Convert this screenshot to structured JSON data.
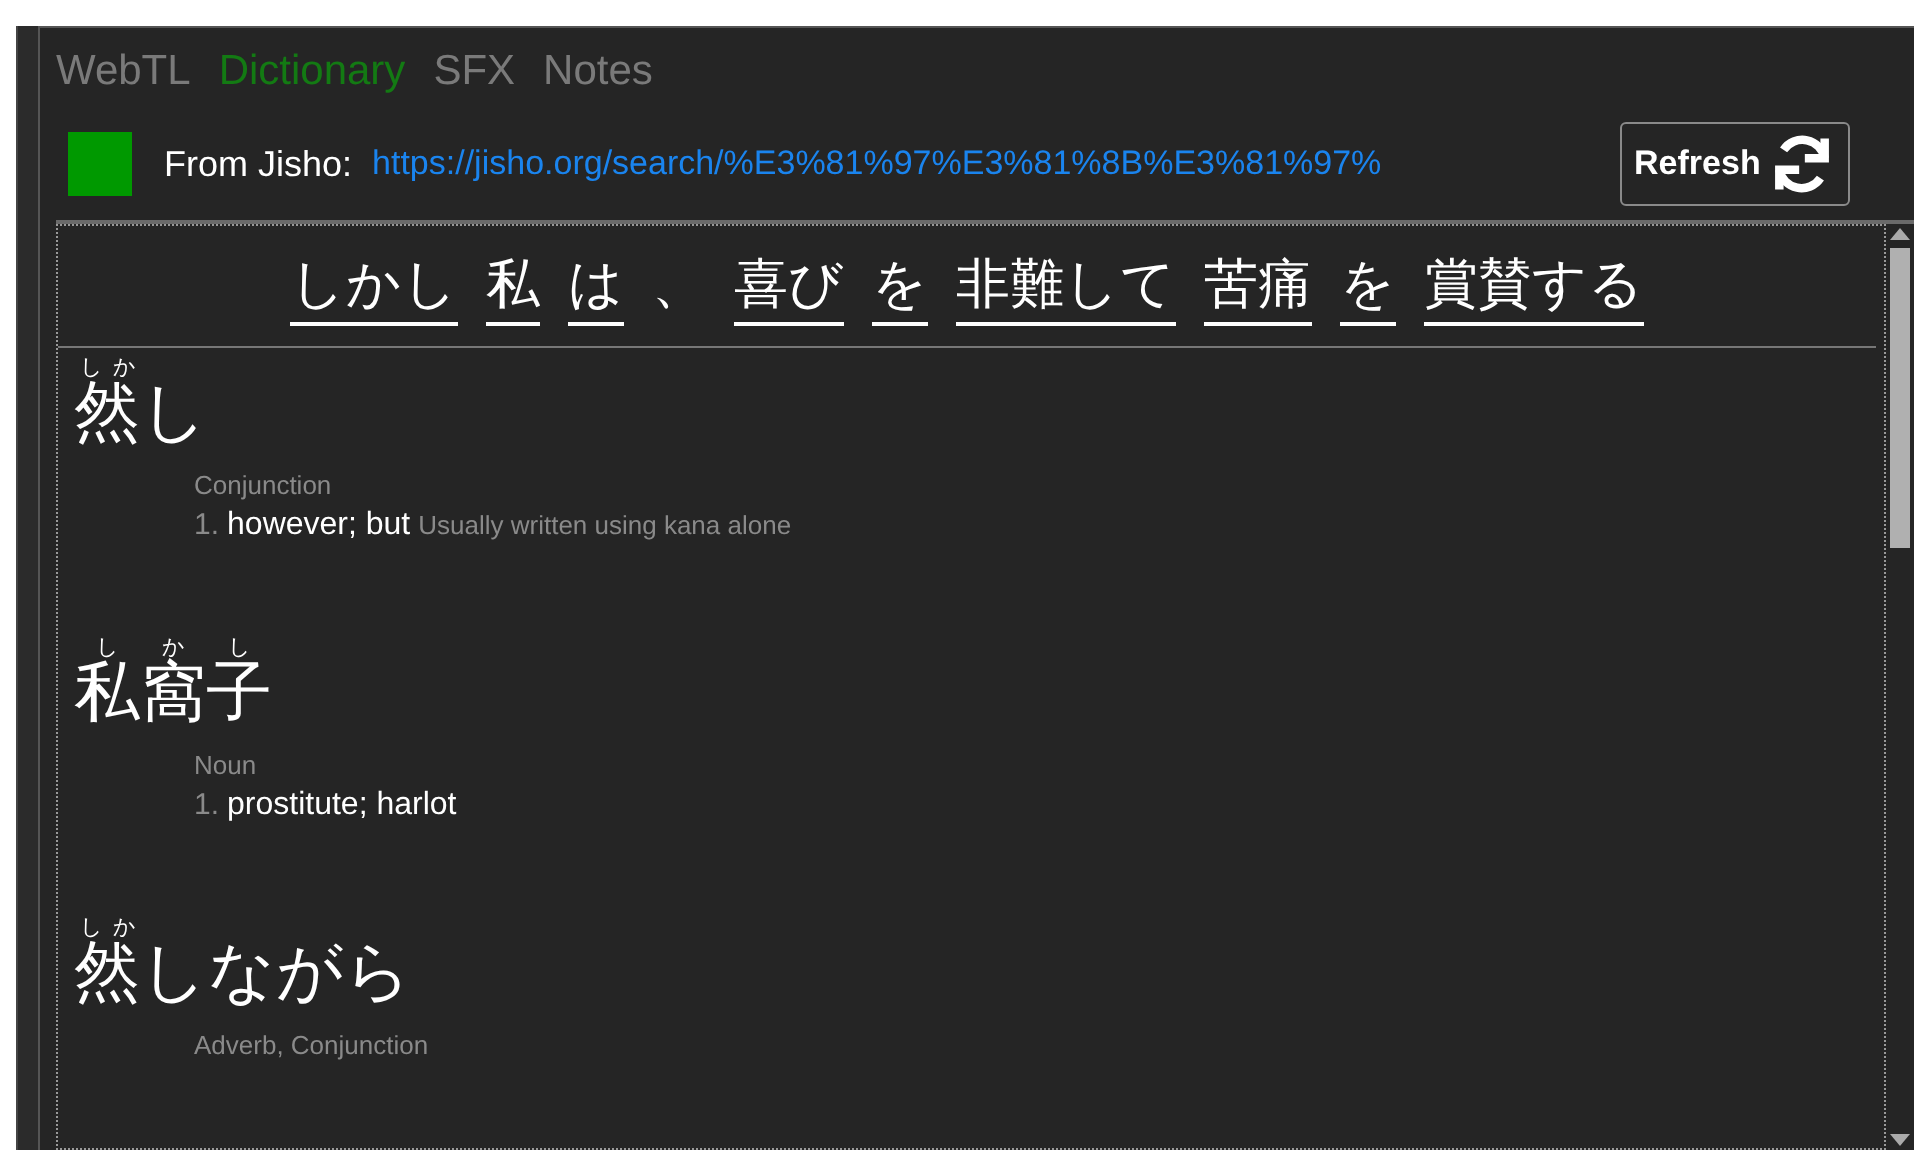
{
  "tabs": [
    {
      "label": "WebTL",
      "selected": false
    },
    {
      "label": "Dictionary",
      "selected": true
    },
    {
      "label": "SFX",
      "selected": false
    },
    {
      "label": "Notes",
      "selected": false
    }
  ],
  "source": {
    "connected": true,
    "label": "From Jisho:",
    "url": "https://jisho.org/search/%E3%81%97%E3%81%8B%E3%81%97%",
    "refresh_label": "Refresh"
  },
  "sentence": [
    {
      "text": "しかし",
      "underlined": true
    },
    {
      "text": "私",
      "underlined": true
    },
    {
      "text": "は",
      "underlined": true
    },
    {
      "text": "、",
      "underlined": false
    },
    {
      "text": "喜び",
      "underlined": true
    },
    {
      "text": "を",
      "underlined": true
    },
    {
      "text": "非難して",
      "underlined": true
    },
    {
      "text": "苦痛",
      "underlined": true
    },
    {
      "text": "を",
      "underlined": true
    },
    {
      "text": "賞賛する",
      "underlined": true
    }
  ],
  "entries": [
    {
      "word": [
        {
          "text": "然",
          "ruby": "しか"
        },
        {
          "text": "し"
        }
      ],
      "pos": "Conjunction",
      "senses": [
        {
          "number": "1.",
          "gloss": "however; but",
          "note": "Usually written using kana alone"
        }
      ]
    },
    {
      "word": [
        {
          "text": "私",
          "ruby": "し"
        },
        {
          "text": "窩",
          "ruby": "か"
        },
        {
          "text": "子",
          "ruby": "し"
        }
      ],
      "pos": "Noun",
      "senses": [
        {
          "number": "1.",
          "gloss": "prostitute; harlot"
        }
      ]
    },
    {
      "word": [
        {
          "text": "然",
          "ruby": "しか"
        },
        {
          "text": "しながら"
        }
      ],
      "pos": "Adverb, Conjunction"
    }
  ]
}
